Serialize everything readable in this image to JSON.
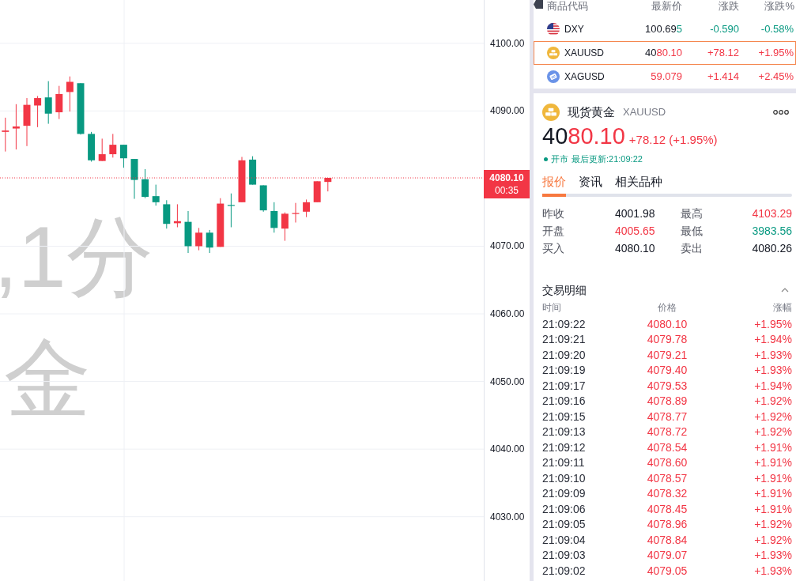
{
  "chart": {
    "symbol_watermark": [
      ",1分",
      "金"
    ],
    "countdown": "00:35",
    "chart_data": [
      {
        "type": "candlestick",
        "ohlc": [
          [
            4086.9,
            4089.0,
            4084.0,
            4087.1
          ],
          [
            4087.4,
            4091.0,
            4084.3,
            4087.7
          ],
          [
            4087.8,
            4091.9,
            4084.8,
            4090.9
          ],
          [
            4090.8,
            4092.2,
            4087.6,
            4091.9
          ],
          [
            4092.0,
            4094.4,
            4088.1,
            4089.6
          ],
          [
            4089.8,
            4093.7,
            4088.8,
            4092.5
          ],
          [
            4092.8,
            4095.1,
            4089.9,
            4094.3
          ],
          [
            4094.1,
            4094.1,
            4086.5,
            4086.6
          ],
          [
            4086.6,
            4086.9,
            4082.5,
            4082.7
          ],
          [
            4082.6,
            4085.9,
            4082.6,
            4083.6
          ],
          [
            4083.6,
            4086.6,
            4083.1,
            4085.0
          ],
          [
            4085.0,
            4085.0,
            4081.6,
            4083.0
          ],
          [
            4082.9,
            4082.9,
            4077.0,
            4079.8
          ],
          [
            4079.9,
            4081.4,
            4077.1,
            4077.3
          ],
          [
            4077.4,
            4079.1,
            4076.0,
            4076.5
          ],
          [
            4076.2,
            4076.8,
            4072.6,
            4073.3
          ],
          [
            4073.4,
            4076.2,
            4072.8,
            4073.7
          ],
          [
            4073.6,
            4075.2,
            4069.0,
            4070.0
          ],
          [
            4070.0,
            4072.7,
            4069.4,
            4072.0
          ],
          [
            4072.0,
            4072.4,
            4069.0,
            4069.8
          ],
          [
            4069.9,
            4077.1,
            4069.9,
            4076.3
          ],
          [
            4076.1,
            4077.8,
            4072.8,
            4076.0
          ],
          [
            4076.5,
            4083.2,
            4076.5,
            4082.7
          ],
          [
            4082.8,
            4083.3,
            4079.1,
            4079.1
          ],
          [
            4079.0,
            4079.0,
            4075.1,
            4075.3
          ],
          [
            4075.2,
            4076.5,
            4072.0,
            4072.7
          ],
          [
            4072.6,
            4075.0,
            4070.8,
            4074.8
          ],
          [
            4074.8,
            4076.4,
            4073.5,
            4074.9
          ],
          [
            4075.1,
            4076.9,
            4074.3,
            4076.5
          ],
          [
            4076.5,
            4079.6,
            4076.5,
            4079.6
          ],
          [
            4079.5,
            4080.1,
            4078.1,
            4080.1
          ],
          null,
          null,
          null,
          null,
          null,
          null,
          null,
          null,
          null,
          null,
          null,
          null,
          null,
          null
        ],
        "ylim": [
          4020.5,
          4106.4
        ],
        "yticks": [
          {
            "value": 4030,
            "label": "4030.00"
          },
          {
            "value": 4040,
            "label": "4040.00"
          },
          {
            "value": 4050,
            "label": "4050.00"
          },
          {
            "value": 4060,
            "label": "4060.00"
          },
          {
            "value": 4070,
            "label": "4070.00"
          },
          {
            "value": 4090,
            "label": "4090.00"
          },
          {
            "value": 4100,
            "label": "4100.00"
          }
        ],
        "grid": true,
        "ref_lines": [
          {
            "axis": "y",
            "value": 4080.1,
            "label": "4080.10",
            "color": "#f23645",
            "line_style": "dotted"
          }
        ]
      }
    ]
  },
  "watchlist": {
    "columns": [
      "商品代码",
      "最新价",
      "涨跌",
      "涨跌%"
    ],
    "rows": [
      {
        "kind": "index",
        "symbol": "DXY",
        "price_prefix": "100.69",
        "price_changed": "5",
        "change": "-0.590",
        "change_pct": "-0.58%",
        "rising": false,
        "selected": false
      },
      {
        "kind": "gold",
        "symbol": "XAUUSD",
        "price_prefix": "40",
        "price_changed": "80.10",
        "change": "+78.12",
        "change_pct": "+1.95%",
        "rising": true,
        "selected": true
      },
      {
        "kind": "silver",
        "symbol": "XAGUSD",
        "price_changed": "59.079",
        "change": "+1.414",
        "change_pct": "+2.45%",
        "rising": true,
        "selected": false
      }
    ]
  },
  "detail": {
    "kind": "gold",
    "name": "现货黄金",
    "symbol": "XAUUSD",
    "price_prefix": "40",
    "price_changed": "80.10",
    "change": "+78.12 (+1.95%)",
    "rising": true,
    "market_status": "开市",
    "last_update": "最后更新:21:09:22",
    "tabs": [
      {
        "label": "报价",
        "selected": true
      },
      {
        "label": "资讯",
        "selected": false
      },
      {
        "label": "相关品种",
        "selected": false
      }
    ],
    "stats": [
      {
        "label": "昨收",
        "value": "4001.98",
        "color": "#131722"
      },
      {
        "label": "最高",
        "value": "4103.29",
        "color": "#f23645"
      },
      {
        "label": "开盘",
        "value": "4005.65",
        "color": "#f23645"
      },
      {
        "label": "最低",
        "value": "3983.56",
        "color": "#089981"
      },
      {
        "label": "买入",
        "value": "4080.10",
        "color": "#131722"
      },
      {
        "label": "卖出",
        "value": "4080.26",
        "color": "#131722"
      }
    ]
  },
  "trades": {
    "title": "交易明细",
    "expanded": true,
    "columns": [
      "时间",
      "价格",
      "涨幅"
    ],
    "rows": [
      {
        "time": "21:09:22",
        "price": "4080.10",
        "change_pct": "+1.95%",
        "rising": true
      },
      {
        "time": "21:09:21",
        "price": "4079.78",
        "change_pct": "+1.94%",
        "rising": true
      },
      {
        "time": "21:09:20",
        "price": "4079.21",
        "change_pct": "+1.93%",
        "rising": true
      },
      {
        "time": "21:09:19",
        "price": "4079.40",
        "change_pct": "+1.93%",
        "rising": true
      },
      {
        "time": "21:09:17",
        "price": "4079.53",
        "change_pct": "+1.94%",
        "rising": true
      },
      {
        "time": "21:09:16",
        "price": "4078.89",
        "change_pct": "+1.92%",
        "rising": true
      },
      {
        "time": "21:09:15",
        "price": "4078.77",
        "change_pct": "+1.92%",
        "rising": true
      },
      {
        "time": "21:09:13",
        "price": "4078.72",
        "change_pct": "+1.92%",
        "rising": true
      },
      {
        "time": "21:09:12",
        "price": "4078.54",
        "change_pct": "+1.91%",
        "rising": true
      },
      {
        "time": "21:09:11",
        "price": "4078.60",
        "change_pct": "+1.91%",
        "rising": true
      },
      {
        "time": "21:09:10",
        "price": "4078.57",
        "change_pct": "+1.91%",
        "rising": true
      },
      {
        "time": "21:09:09",
        "price": "4078.32",
        "change_pct": "+1.91%",
        "rising": true
      },
      {
        "time": "21:09:06",
        "price": "4078.45",
        "change_pct": "+1.91%",
        "rising": true
      },
      {
        "time": "21:09:05",
        "price": "4078.96",
        "change_pct": "+1.92%",
        "rising": true
      },
      {
        "time": "21:09:04",
        "price": "4078.84",
        "change_pct": "+1.92%",
        "rising": true
      },
      {
        "time": "21:09:03",
        "price": "4079.07",
        "change_pct": "+1.93%",
        "rising": true
      },
      {
        "time": "21:09:02",
        "price": "4079.05",
        "change_pct": "+1.93%",
        "rising": true
      }
    ]
  }
}
